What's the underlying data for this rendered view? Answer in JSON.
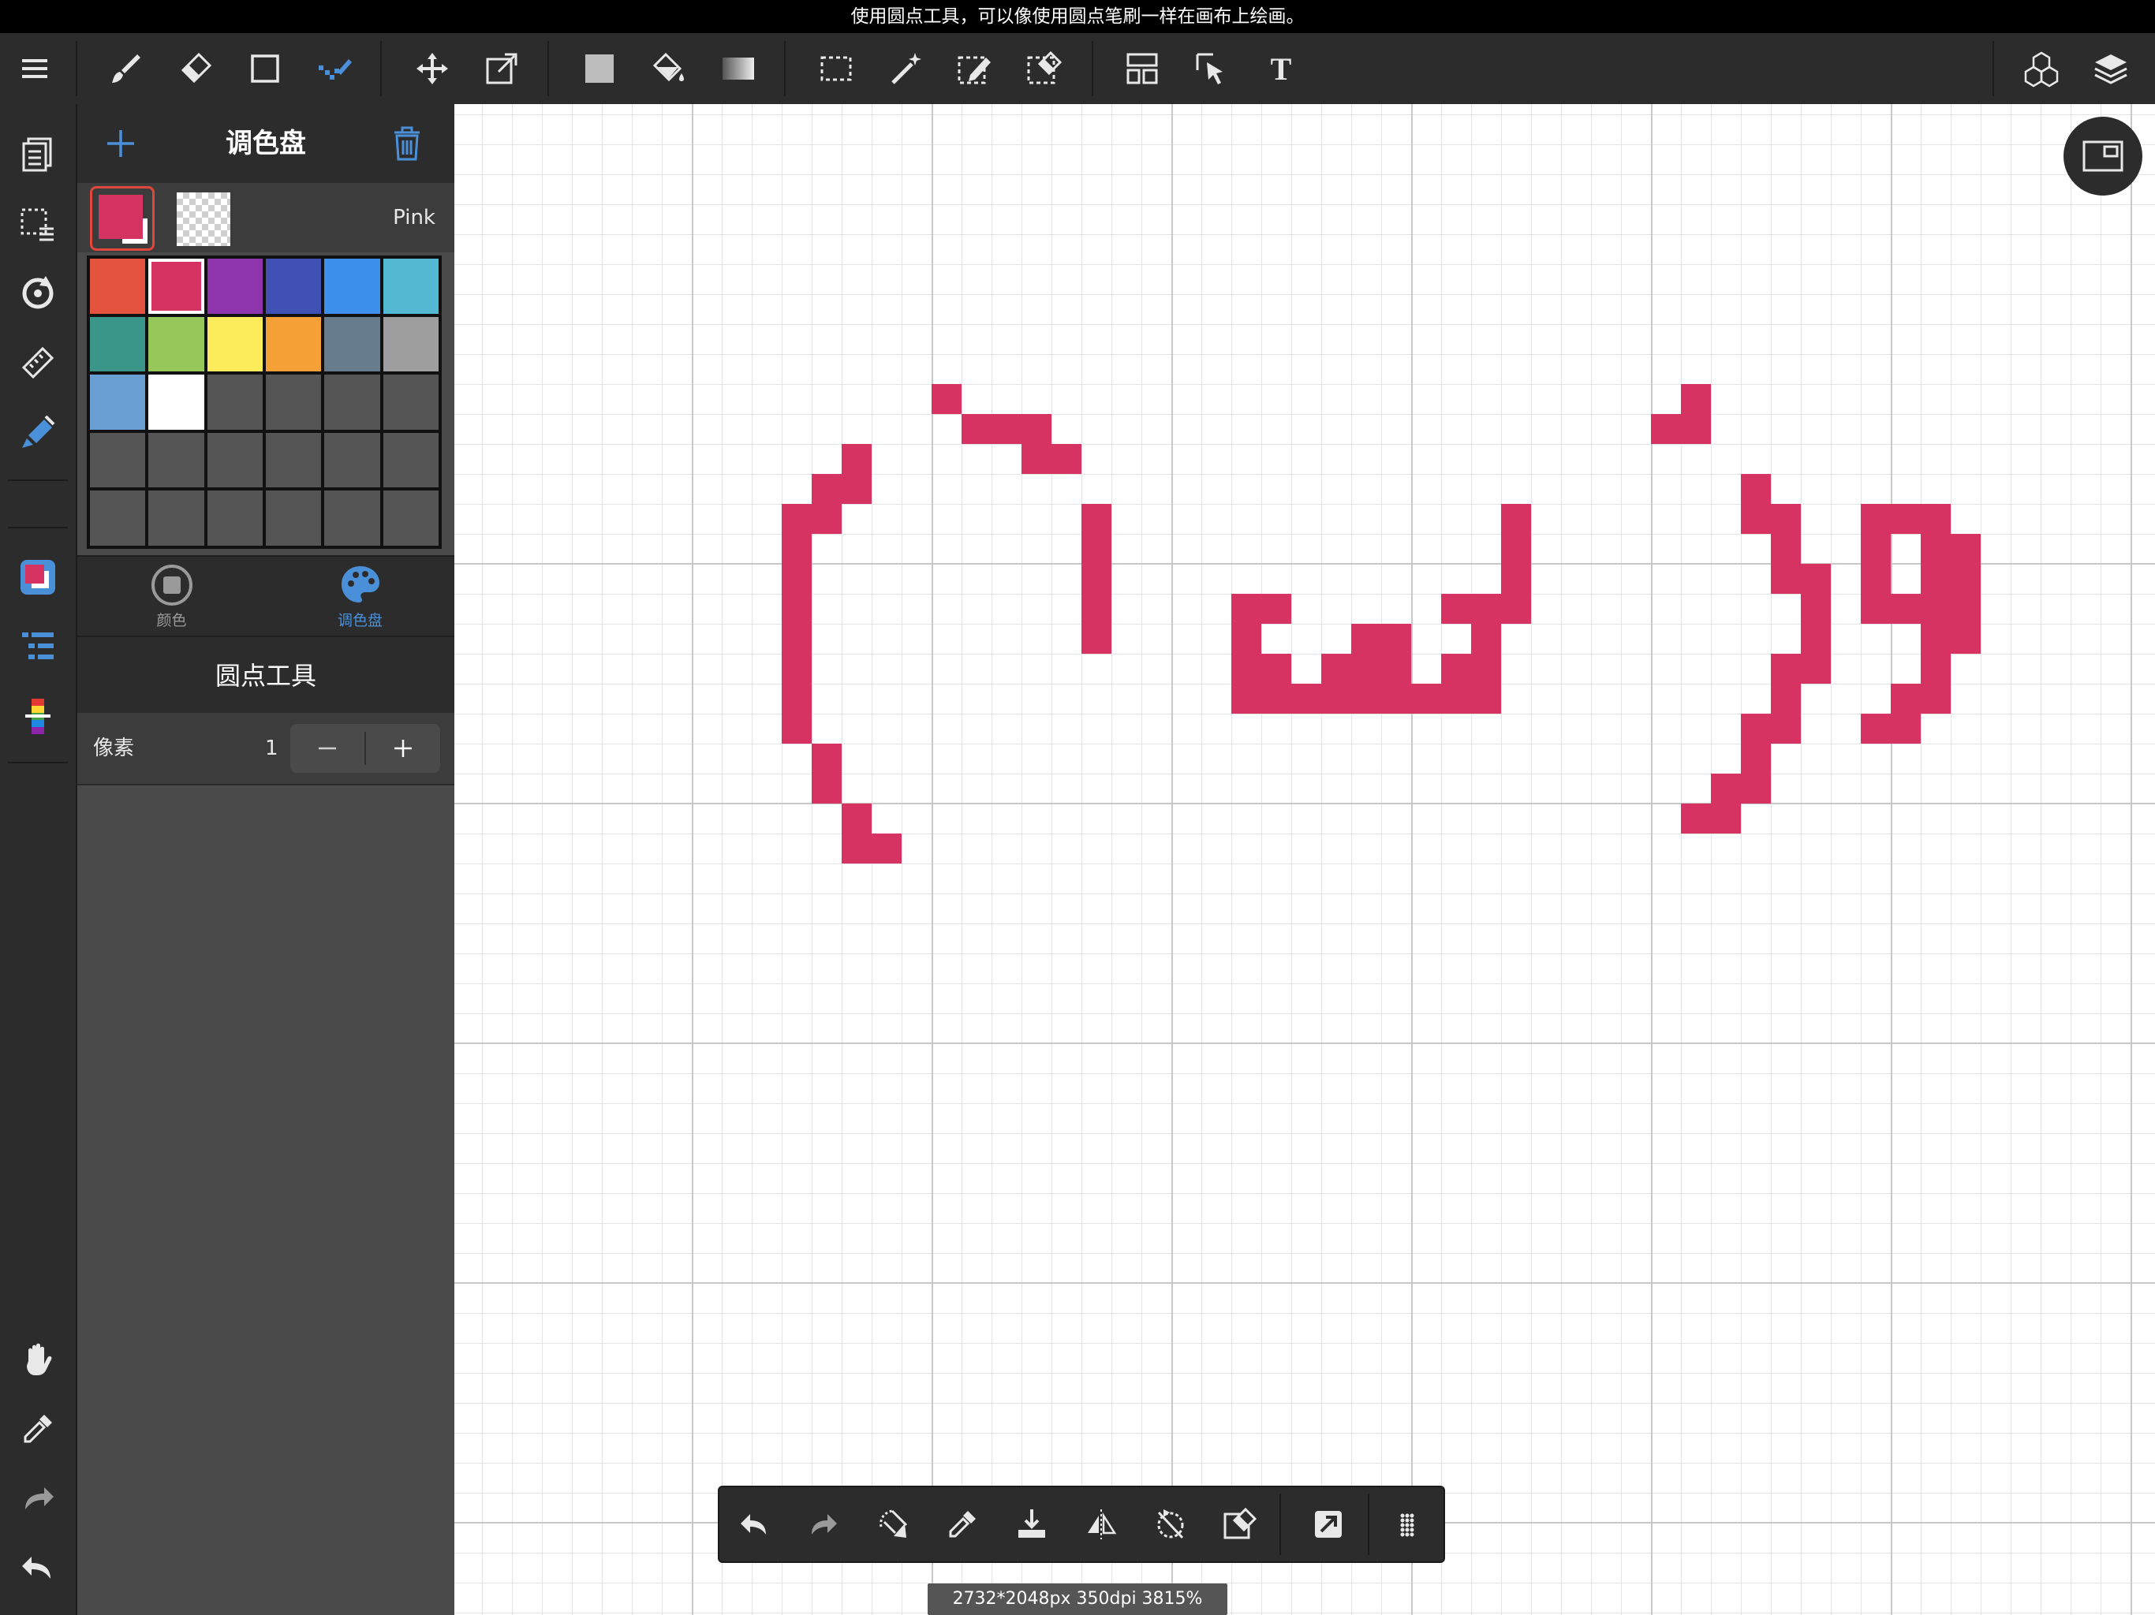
{
  "hint_bar": {
    "text": "使用圆点工具，可以像使用圆点笔刷一样在画布上绘画。"
  },
  "colors": {
    "accent": "#4a90d9",
    "pink": "#d63362",
    "toolbar_bg": "#2c2c2c",
    "icon": "#e8e8e8"
  },
  "toolbar": {
    "menu_icon": "menu-icon",
    "tools": [
      {
        "name": "brush-icon"
      },
      {
        "name": "eraser-icon"
      },
      {
        "name": "shape-icon"
      },
      {
        "name": "dot-tool-icon",
        "active": true
      },
      {
        "name": "move-icon"
      },
      {
        "name": "transform-icon"
      },
      {
        "name": "fill-color-icon"
      },
      {
        "name": "bucket-icon"
      },
      {
        "name": "gradient-icon"
      },
      {
        "name": "select-rect-icon"
      },
      {
        "name": "magic-wand-icon"
      },
      {
        "name": "select-pen-icon"
      },
      {
        "name": "select-eraser-icon"
      },
      {
        "name": "frame-divide-icon"
      },
      {
        "name": "operation-icon"
      },
      {
        "name": "text-icon"
      }
    ],
    "right_tools": [
      {
        "name": "3d-material-icon"
      },
      {
        "name": "layers-icon"
      }
    ]
  },
  "left_rail": {
    "items": [
      {
        "name": "pages-icon"
      },
      {
        "name": "selection-layer-icon"
      },
      {
        "name": "rotate-canvas-icon"
      },
      {
        "name": "ruler-icon"
      },
      {
        "name": "brush-settings-icon",
        "active": true
      },
      {
        "name": "color-swatch-icon",
        "active": true
      },
      {
        "name": "brush-list-icon"
      },
      {
        "name": "color-slider-icon"
      },
      {
        "name": "hand-icon"
      },
      {
        "name": "eyedropper-icon"
      },
      {
        "name": "redo-icon"
      },
      {
        "name": "undo-icon"
      }
    ]
  },
  "palette": {
    "title": "调色盘",
    "current_color_name": "Pink",
    "current_color": "#d63362",
    "swatches": [
      "#e4533e",
      "#d63362",
      "#8e35ad",
      "#3f51b5",
      "#3d91ec",
      "#53b9d3",
      "#3a9688",
      "#97c75a",
      "#fceb5a",
      "#f5a138",
      "#677c8c",
      "#9e9e9e",
      "#6a9fd3",
      "#ffffff",
      "#555555",
      "#555555",
      "#555555",
      "#555555",
      "#555555",
      "#555555",
      "#555555",
      "#555555",
      "#555555",
      "#555555",
      "#555555",
      "#555555",
      "#555555",
      "#555555",
      "#555555",
      "#555555"
    ],
    "selected_index": 1,
    "tabs": [
      {
        "label": "颜色",
        "icon": "color-circle-icon",
        "active": false
      },
      {
        "label": "调色盘",
        "icon": "palette-icon",
        "active": true
      }
    ]
  },
  "tool_settings": {
    "title": "圆点工具",
    "pixel_label": "像素",
    "pixel_value": "1"
  },
  "canvas": {
    "view_button_icon": "view-mode-icon",
    "pixel_color": "#d63362"
  },
  "bottom_toolbar": {
    "items": [
      {
        "name": "undo-icon"
      },
      {
        "name": "redo-icon"
      },
      {
        "name": "rotate-view-icon"
      },
      {
        "name": "eyedropper-icon"
      },
      {
        "name": "save-icon"
      },
      {
        "name": "flip-icon"
      },
      {
        "name": "reset-rotation-icon"
      },
      {
        "name": "clear-selection-icon"
      },
      {
        "name": "share-icon"
      },
      {
        "name": "more-icon"
      }
    ]
  },
  "status": {
    "text": "2732*2048px 350dpi 3815%"
  }
}
